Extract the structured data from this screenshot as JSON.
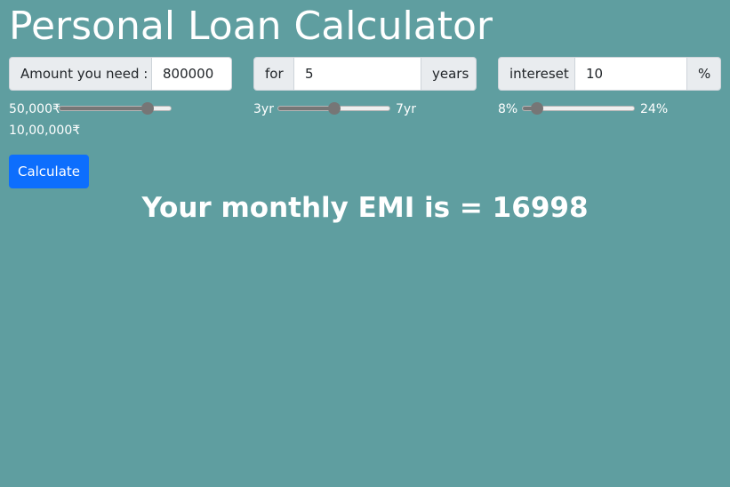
{
  "title": "Personal Loan Calculator",
  "amount": {
    "label": "Amount you need :",
    "value": "800000",
    "slider": {
      "min_label": "50,000₹",
      "max_label": "10,00,000₹",
      "level": 0.79
    }
  },
  "tenure": {
    "label": "for",
    "value": "5",
    "suffix": "years",
    "slider": {
      "min_label": "3yr",
      "max_label": "7yr",
      "level": 0.5
    }
  },
  "interest": {
    "label": "intereset",
    "value": "10",
    "suffix": "%",
    "slider": {
      "min_label": "8%",
      "max_label": "24%",
      "level": 0.125
    }
  },
  "calculate_label": "Calculate",
  "result_text": "Your monthly EMI is = 16998",
  "colors": {
    "background": "#5f9ea0",
    "button": "#0d6efd",
    "addon": "#e9ecef"
  }
}
